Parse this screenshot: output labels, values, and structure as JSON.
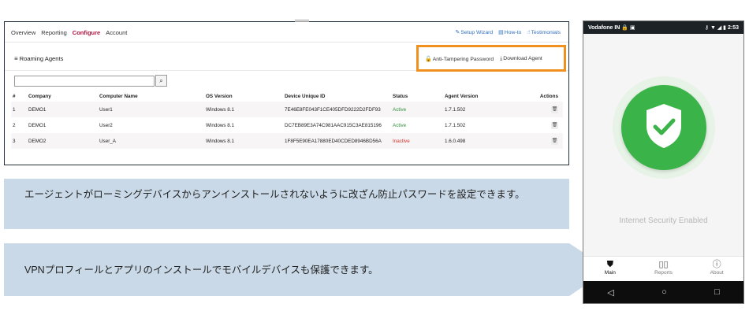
{
  "dashboard": {
    "menu": [
      "Overview",
      "Reporting",
      "Configure",
      "Account"
    ],
    "active_menu": "Configure",
    "links": [
      {
        "icon": "wand-icon",
        "glyph": "✎",
        "label": "Setup Wizard"
      },
      {
        "icon": "book-icon",
        "glyph": "▤",
        "label": "How-to"
      },
      {
        "icon": "thumbs-up-icon",
        "glyph": "☝",
        "label": "Testimonials"
      }
    ],
    "section_title": "Roaming Agents",
    "section_icon": "≡",
    "buttons": {
      "anti_tampering": "Anti-Tampering Password",
      "download_agent": "Download Agent"
    },
    "search": {
      "placeholder": "",
      "button_glyph": "🔍"
    },
    "columns": [
      "#",
      "Company",
      "Computer Name",
      "OS Version",
      "Device Unique ID",
      "Status",
      "Agent Version",
      "Actions"
    ],
    "rows": [
      [
        "1",
        "DEMO1",
        "User1",
        "Windows 8.1",
        "7E46E8FE043F1CE405DFD9222D2FDF93",
        "Active",
        "1.7.1.502"
      ],
      [
        "2",
        "DEMO1",
        "User2",
        "Windows 8.1",
        "DC7EB89E3A74C981AAC915C3AE815196",
        "Active",
        "1.7.1.502"
      ],
      [
        "3",
        "DEMO2",
        "User_A",
        "Windows 8.1",
        "1F8F5E90EA17880ED40CDED8946BD56A",
        "Inactive",
        "1.6.0.498"
      ]
    ],
    "colors": {
      "accent": "#b0123c",
      "highlight": "#f0901e",
      "link": "#2f6fc2",
      "active": "#2f8f3a",
      "inactive": "#d0342c"
    }
  },
  "banners": {
    "text1": "エージェントがローミングデバイスからアンインストールされないように改ざん防止パスワードを設定できます。",
    "text2": "VPNプロフィールとアプリのインストールでモバイルデバイスも保護できます。",
    "color": "#c9d9e7"
  },
  "phone": {
    "carrier": "Vodafone IN",
    "time": "2:53",
    "status_text": "Internet Security Enabled",
    "tabs": [
      {
        "icon": "shield-icon",
        "glyph": "⛊",
        "label": "Main"
      },
      {
        "icon": "bar-chart-icon",
        "glyph": "▯▯",
        "label": "Reports"
      },
      {
        "icon": "info-icon",
        "glyph": "ⓘ",
        "label": "About"
      }
    ],
    "nav": [
      "◁",
      "○",
      "□"
    ],
    "accent": "#3ab348"
  }
}
